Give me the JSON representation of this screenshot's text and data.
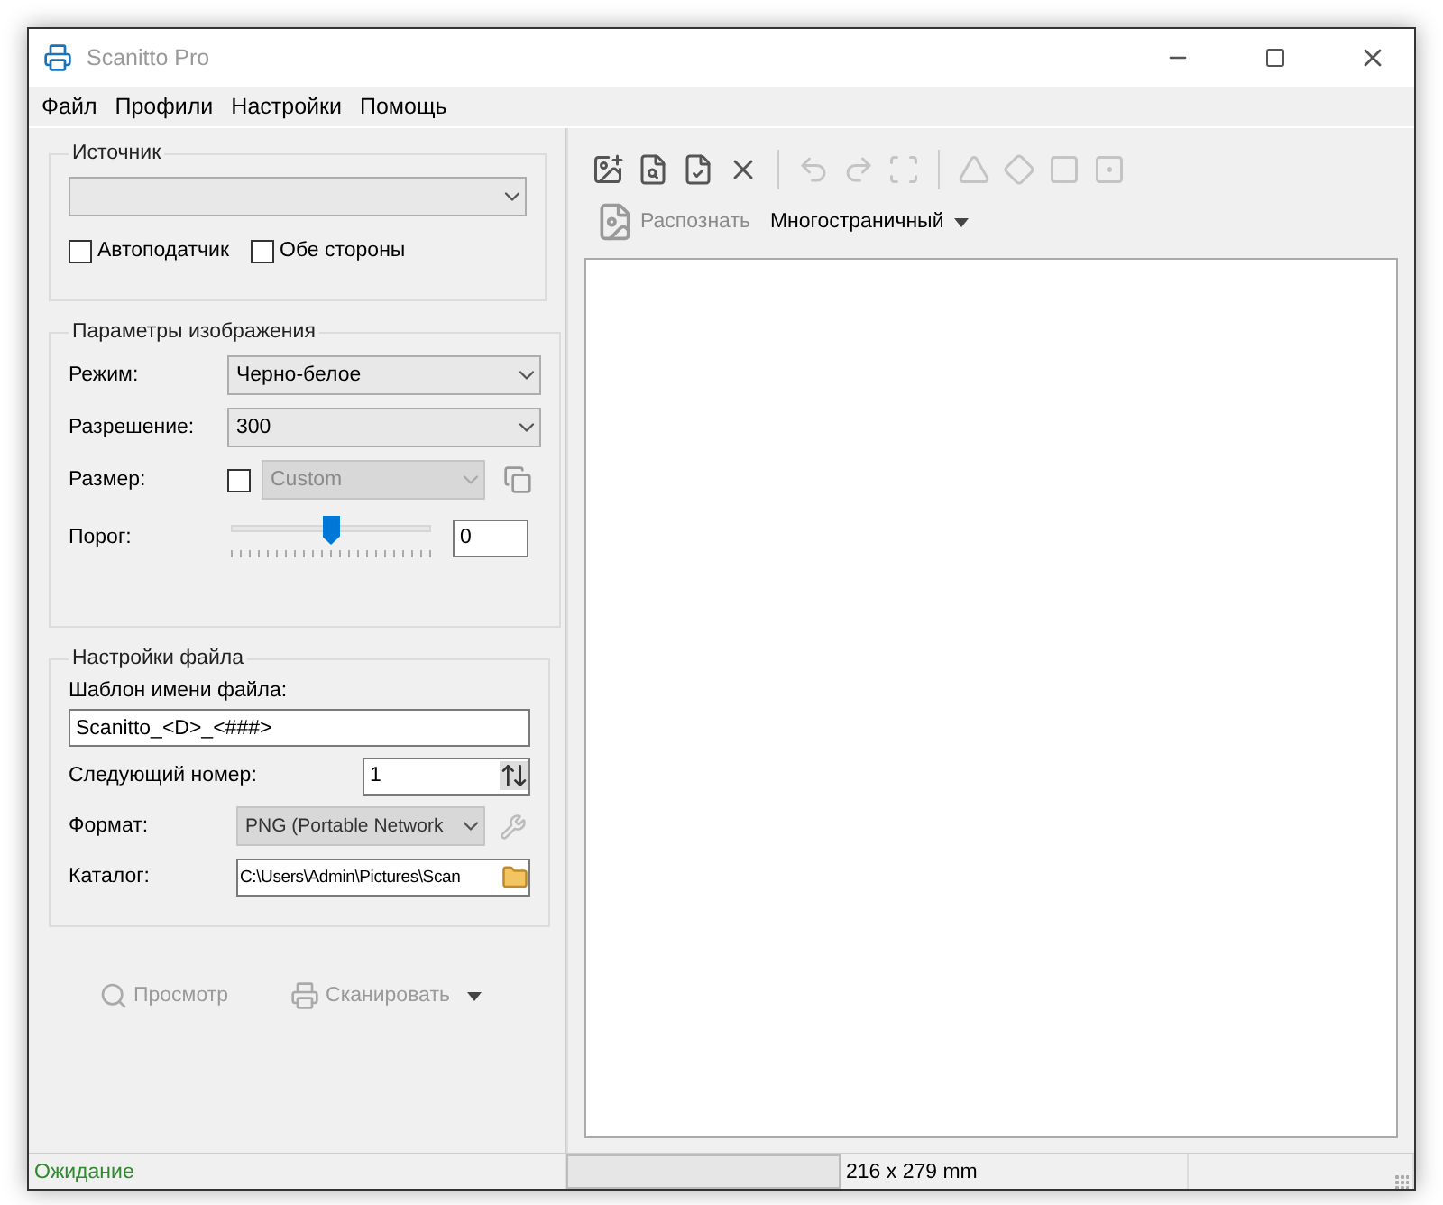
{
  "window": {
    "title": "Scanitto Pro"
  },
  "menu": [
    "Файл",
    "Профили",
    "Настройки",
    "Помощь"
  ],
  "source": {
    "title": "Источник",
    "checkboxes": [
      {
        "label": "Автоподатчик",
        "checked": false
      },
      {
        "label": "Обе стороны",
        "checked": false
      }
    ]
  },
  "image_params": {
    "title": "Параметры изображения",
    "rows": [
      {
        "kind": "select",
        "label": "Режим:",
        "value": "Черно-белое",
        "disabled": false
      },
      {
        "kind": "select",
        "label": "Разрешение:",
        "value": "300",
        "disabled": false
      },
      {
        "kind": "size",
        "label": "Размер:",
        "checked": false,
        "value": "Custom",
        "disabled": true
      },
      {
        "kind": "slider",
        "label": "Порог:",
        "level": 0.5,
        "value": "0"
      }
    ]
  },
  "file_settings": {
    "title": "Настройки файла",
    "template_label": "Шаблон имени файла:",
    "template_value": "Scanitto_<D>_<###>",
    "rows": [
      {
        "kind": "spin",
        "label": "Следующий номер:",
        "value": "1"
      },
      {
        "kind": "format",
        "label": "Формат:",
        "value": "PNG (Portable Network",
        "disabled": true
      },
      {
        "kind": "folder",
        "label": "Каталог:",
        "value": "C:\\Users\\Admin\\Pictures\\Scan"
      }
    ]
  },
  "actions": [
    {
      "kind": "preview",
      "label": "Просмотр",
      "disabled": true
    },
    {
      "kind": "scan",
      "label": "Сканировать",
      "disabled": true
    }
  ],
  "toolbar": [
    {
      "kind": "add",
      "disabled": false
    },
    {
      "kind": "find",
      "disabled": false
    },
    {
      "kind": "check",
      "disabled": false
    },
    {
      "kind": "delete",
      "disabled": false
    },
    {
      "kind": "sep"
    },
    {
      "kind": "undo",
      "disabled": true
    },
    {
      "kind": "redo",
      "disabled": true
    },
    {
      "kind": "fit",
      "disabled": true
    },
    {
      "kind": "sep"
    },
    {
      "kind": "triangle",
      "disabled": true
    },
    {
      "kind": "diamond",
      "disabled": true
    },
    {
      "kind": "square",
      "disabled": true
    },
    {
      "kind": "square2",
      "disabled": true
    }
  ],
  "recognize": {
    "label": "Распознать",
    "disabled": true
  },
  "mode": {
    "label": "Многостраничный"
  },
  "status_bar": {
    "text": "Ожидание",
    "dimensions": "216 x 279 mm"
  }
}
